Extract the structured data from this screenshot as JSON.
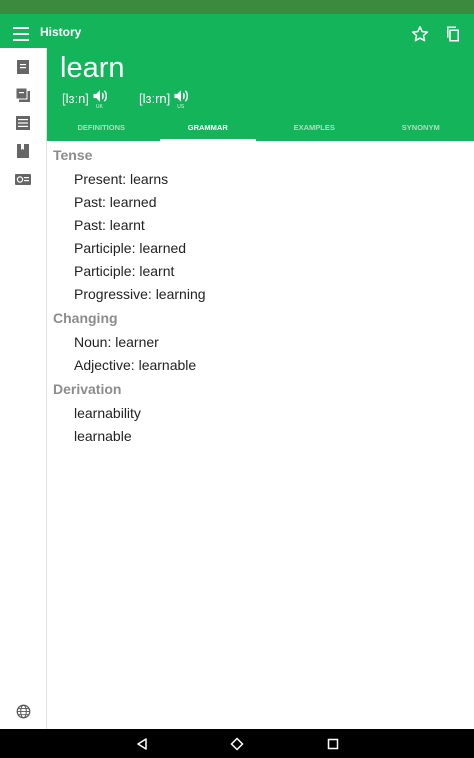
{
  "header": {
    "title": "History",
    "icons": [
      "menu-icon",
      "star-icon",
      "copy-icon"
    ]
  },
  "word": "learn",
  "pronunciations": [
    {
      "ipa": "[lɜːn]",
      "region": "UK"
    },
    {
      "ipa": "[lɜːrn]",
      "region": "US"
    }
  ],
  "tabs": [
    {
      "label": "DEFINITIONS"
    },
    {
      "label": "GRAMMAR"
    },
    {
      "label": "EXAMPLES"
    },
    {
      "label": "SYNONYM"
    }
  ],
  "active_tab": "GRAMMAR",
  "sidebar_icons": [
    "dictionary-icon",
    "cards-icon",
    "list-icon",
    "book-icon",
    "translate-icon",
    "globe-icon"
  ],
  "sections": [
    {
      "title": "Tense",
      "items": [
        "Present: learns",
        "Past: learned",
        "Past: learnt",
        "Participle: learned",
        "Participle: learnt",
        "Progressive: learning"
      ]
    },
    {
      "title": "Changing",
      "items": [
        "Noun: learner",
        "Adjective: learnable"
      ]
    },
    {
      "title": "Derivation",
      "items": [
        "learnability",
        "learnable"
      ]
    }
  ],
  "colors": {
    "primary": "#13b45a",
    "status_bar": "#3c8a3e",
    "section_header": "#8c8c8c"
  }
}
